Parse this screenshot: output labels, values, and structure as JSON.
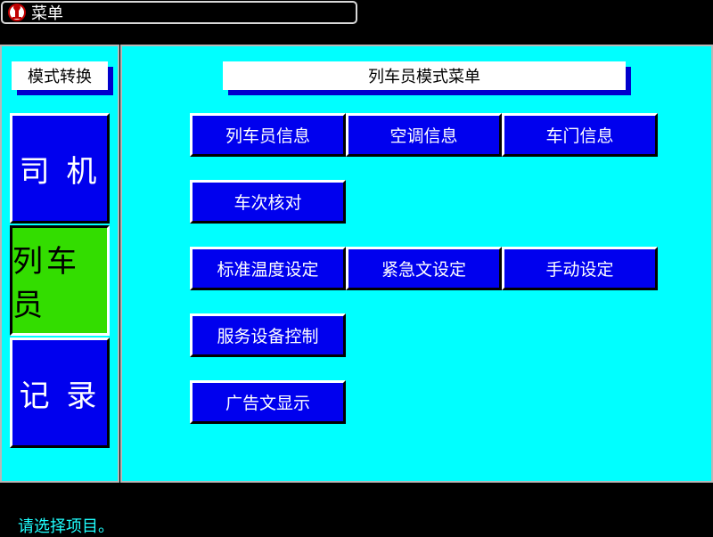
{
  "window": {
    "title": "菜单",
    "logo_icon": "railway-logo-icon"
  },
  "sidebar": {
    "label": "模式转换",
    "modes": [
      {
        "label": "司 机",
        "active": false
      },
      {
        "label": "列车员",
        "active": true
      },
      {
        "label": "记 录",
        "active": false
      }
    ]
  },
  "main": {
    "title": "列车员模式菜单",
    "buttons": [
      {
        "label": "列车员信息"
      },
      {
        "label": "空调信息"
      },
      {
        "label": "车门信息"
      },
      {
        "label": "车次核对"
      },
      {
        "label": "标准温度设定"
      },
      {
        "label": "紧急文设定"
      },
      {
        "label": "手动设定"
      },
      {
        "label": "服务设备控制"
      },
      {
        "label": "广告文显示"
      }
    ]
  },
  "status": {
    "message": "请选择项目。"
  },
  "colors": {
    "panel": "#00ffff",
    "button": "#0000ee",
    "active": "#33dd00",
    "shadow": "#0000cc",
    "status_text": "#20ffff"
  }
}
